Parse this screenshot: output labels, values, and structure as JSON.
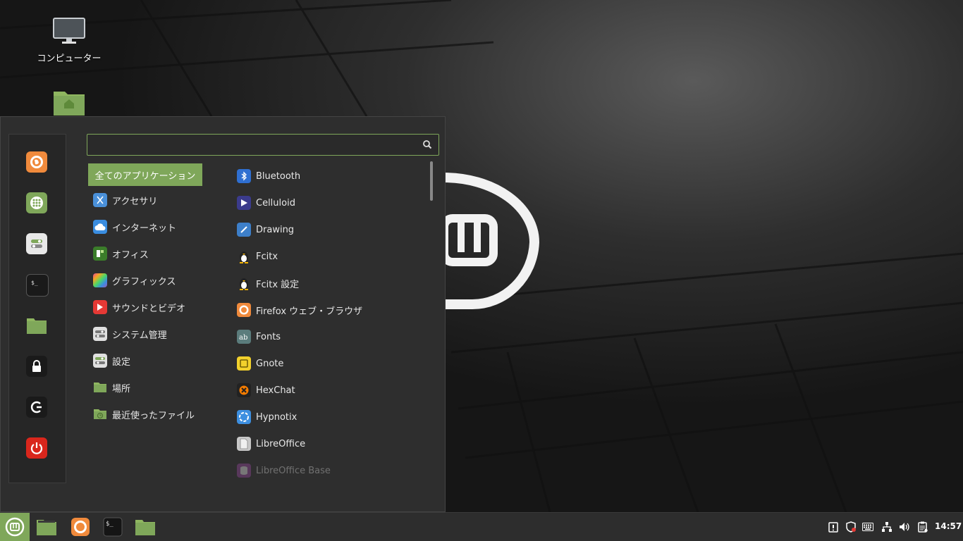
{
  "desktop": {
    "icons": [
      {
        "label": "コンピューター",
        "icon": "computer-icon"
      },
      {
        "label": "",
        "icon": "home-folder-icon"
      }
    ]
  },
  "menu": {
    "search": {
      "value": "",
      "placeholder": ""
    },
    "favorites": [
      {
        "name": "Firefox",
        "icon": "firefox-icon"
      },
      {
        "name": "Software Manager",
        "icon": "software-manager-icon"
      },
      {
        "name": "System Settings",
        "icon": "settings-icon"
      },
      {
        "name": "Terminal",
        "icon": "terminal-icon"
      },
      {
        "name": "Files",
        "icon": "folder-icon"
      },
      {
        "name": "Lock Screen",
        "icon": "lock-icon"
      },
      {
        "name": "Logout",
        "icon": "logout-icon"
      },
      {
        "name": "Quit",
        "icon": "power-icon"
      }
    ],
    "categories": [
      {
        "label": "全てのアプリケーション",
        "selected": true
      },
      {
        "label": "アクセサリ",
        "icon": "accessories-icon"
      },
      {
        "label": "インターネット",
        "icon": "internet-icon"
      },
      {
        "label": "オフィス",
        "icon": "office-icon"
      },
      {
        "label": "グラフィックス",
        "icon": "graphics-icon"
      },
      {
        "label": "サウンドとビデオ",
        "icon": "multimedia-icon"
      },
      {
        "label": "システム管理",
        "icon": "system-admin-icon"
      },
      {
        "label": "設定",
        "icon": "preferences-icon"
      },
      {
        "label": "場所",
        "icon": "places-folder-icon"
      },
      {
        "label": "最近使ったファイル",
        "icon": "recent-files-icon"
      }
    ],
    "apps": [
      {
        "label": "Bluetooth",
        "icon": "bluetooth-icon"
      },
      {
        "label": "Celluloid",
        "icon": "celluloid-icon"
      },
      {
        "label": "Drawing",
        "icon": "drawing-icon"
      },
      {
        "label": "Fcitx",
        "icon": "fcitx-penguin-icon"
      },
      {
        "label": "Fcitx 設定",
        "icon": "fcitx-config-penguin-icon"
      },
      {
        "label": "Firefox ウェブ・ブラウザ",
        "icon": "firefox-icon"
      },
      {
        "label": "Fonts",
        "icon": "fonts-icon"
      },
      {
        "label": "Gnote",
        "icon": "gnote-icon"
      },
      {
        "label": "HexChat",
        "icon": "hexchat-icon"
      },
      {
        "label": "Hypnotix",
        "icon": "hypnotix-icon"
      },
      {
        "label": "LibreOffice",
        "icon": "libreoffice-icon"
      },
      {
        "label": "LibreOffice Base",
        "icon": "libreoffice-base-icon"
      }
    ]
  },
  "panel": {
    "launchers": [
      "menu-icon",
      "files-icon",
      "firefox-icon",
      "terminal-icon",
      "folder-icon"
    ],
    "tray": [
      "update-manager-icon",
      "shield-icon",
      "keyboard-icon",
      "network-icon",
      "volume-icon",
      "clipboard-icon"
    ],
    "clock": "14:57"
  },
  "colors": {
    "accent": "#7fa75a",
    "menu_bg": "#2e2e2e",
    "panel_bg": "#2d2d2d"
  }
}
